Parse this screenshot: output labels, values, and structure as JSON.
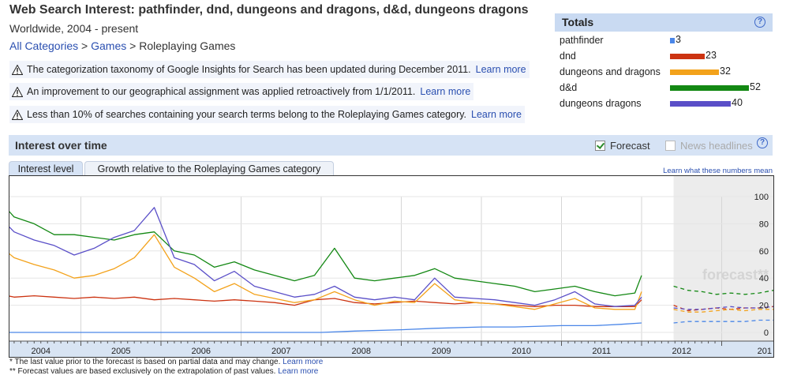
{
  "header": {
    "title": "Web Search Interest: pathfinder, dnd, dungeons and dragons, d&d, dungeons dragons",
    "subtitle": "Worldwide, 2004 - present",
    "breadcrumb": [
      "All Categories",
      "Games",
      "Roleplaying Games"
    ],
    "breadcrumb_sep": ">"
  },
  "notices": [
    {
      "text": "The categorization taxonomy of Google Insights for Search has been updated during December 2011.",
      "link": "Learn more"
    },
    {
      "text": "An improvement to our geographical assignment was applied retroactively from 1/1/2011.",
      "link": "Learn more"
    },
    {
      "text": "Less than 10% of searches containing your search terms belong to the Roleplaying Games category.",
      "link": "Learn more"
    }
  ],
  "totals": {
    "title": "Totals",
    "help_icon": "?",
    "rows": [
      {
        "name": "pathfinder",
        "value": 3,
        "color": "#4a86e8"
      },
      {
        "name": "dnd",
        "value": 23,
        "color": "#cc3311"
      },
      {
        "name": "dungeons and dragons",
        "value": 32,
        "color": "#f3a21b"
      },
      {
        "name": "d&d",
        "value": 52,
        "color": "#138813"
      },
      {
        "name": "dungeons dragons",
        "value": 40,
        "color": "#5a4fc8"
      }
    ]
  },
  "interest": {
    "title": "Interest over time",
    "forecast_label": "Forecast",
    "forecast_checked": true,
    "headlines_label": "News headlines",
    "headlines_checked": false,
    "help_icon": "?"
  },
  "tabs": [
    {
      "label": "Interest level",
      "active": true
    },
    {
      "label": "Growth relative to the Roleplaying Games category",
      "active": false
    }
  ],
  "learn_numbers": "Learn what these numbers mean",
  "footnotes": [
    {
      "text": "* The last value prior to the forecast is based on partial data and may change.",
      "link": "Learn more"
    },
    {
      "text": "** Forecast values are based exclusively on the extrapolation of past values.",
      "link": "Learn more"
    }
  ],
  "chart_data": {
    "type": "line",
    "x_start": "2004-01",
    "x_tick_labels": [
      "2004",
      "2005",
      "2006",
      "2007",
      "2008",
      "2009",
      "2010",
      "2011",
      "2012",
      "201"
    ],
    "y_ticks": [
      0,
      20,
      40,
      60,
      80,
      100
    ],
    "ylim": [
      0,
      100
    ],
    "forecast_label": "forecast**",
    "forecast_start": "2012-01",
    "series": [
      {
        "name": "pathfinder",
        "color": "#4a86e8",
        "x": [
          "2004-01",
          "2006-01",
          "2008-01",
          "2008-06",
          "2009-01",
          "2009-06",
          "2010-01",
          "2010-06",
          "2011-01",
          "2011-06",
          "2011-10",
          "2012-01"
        ],
        "values": [
          0,
          0,
          0,
          1,
          2,
          3,
          4,
          4,
          5,
          5,
          6,
          7
        ],
        "forecast": [
          7,
          8,
          8,
          8,
          8,
          8,
          9,
          9
        ]
      },
      {
        "name": "dnd",
        "color": "#cc3311",
        "x": [
          "2004-01",
          "2004-03",
          "2004-06",
          "2004-09",
          "2004-12",
          "2005-03",
          "2005-06",
          "2005-09",
          "2005-12",
          "2006-03",
          "2006-06",
          "2006-09",
          "2006-12",
          "2007-03",
          "2007-06",
          "2007-09",
          "2007-12",
          "2008-03",
          "2008-06",
          "2008-09",
          "2008-12",
          "2009-03",
          "2009-06",
          "2009-09",
          "2009-12",
          "2010-03",
          "2010-06",
          "2010-09",
          "2010-12",
          "2011-03",
          "2011-06",
          "2011-09",
          "2011-12",
          "2012-01"
        ],
        "values": [
          28,
          26,
          27,
          26,
          25,
          26,
          25,
          26,
          24,
          25,
          24,
          23,
          24,
          23,
          22,
          20,
          24,
          25,
          22,
          21,
          22,
          23,
          22,
          21,
          22,
          21,
          20,
          19,
          20,
          20,
          19,
          19,
          19,
          24
        ],
        "forecast": [
          20,
          16,
          17,
          18,
          17,
          18,
          18,
          19
        ]
      },
      {
        "name": "dungeons and dragons",
        "color": "#f3a21b",
        "x": [
          "2004-01",
          "2004-03",
          "2004-06",
          "2004-09",
          "2004-12",
          "2005-03",
          "2005-06",
          "2005-09",
          "2005-12",
          "2006-03",
          "2006-06",
          "2006-09",
          "2006-12",
          "2007-03",
          "2007-06",
          "2007-09",
          "2007-12",
          "2008-03",
          "2008-06",
          "2008-09",
          "2008-12",
          "2009-03",
          "2009-06",
          "2009-09",
          "2009-12",
          "2010-03",
          "2010-06",
          "2010-09",
          "2010-12",
          "2011-03",
          "2011-06",
          "2011-09",
          "2011-12",
          "2012-01"
        ],
        "values": [
          63,
          55,
          50,
          46,
          40,
          42,
          47,
          55,
          72,
          48,
          40,
          30,
          36,
          28,
          25,
          22,
          24,
          30,
          24,
          20,
          23,
          22,
          36,
          24,
          22,
          21,
          19,
          17,
          21,
          25,
          18,
          17,
          17,
          30
        ],
        "forecast": [
          17,
          15,
          15,
          16,
          17,
          16,
          17,
          17
        ]
      },
      {
        "name": "d&d",
        "color": "#138813",
        "x": [
          "2004-01",
          "2004-03",
          "2004-06",
          "2004-09",
          "2004-12",
          "2005-03",
          "2005-06",
          "2005-09",
          "2005-12",
          "2006-03",
          "2006-06",
          "2006-09",
          "2006-12",
          "2007-03",
          "2007-06",
          "2007-09",
          "2007-12",
          "2008-03",
          "2008-06",
          "2008-09",
          "2008-12",
          "2009-03",
          "2009-06",
          "2009-09",
          "2009-12",
          "2010-03",
          "2010-06",
          "2010-09",
          "2010-12",
          "2011-03",
          "2011-06",
          "2011-09",
          "2011-12",
          "2012-01"
        ],
        "values": [
          96,
          85,
          80,
          72,
          72,
          70,
          68,
          72,
          74,
          60,
          57,
          48,
          52,
          46,
          42,
          38,
          42,
          62,
          40,
          38,
          40,
          42,
          47,
          40,
          38,
          36,
          34,
          30,
          32,
          34,
          30,
          27,
          29,
          42
        ],
        "forecast": [
          34,
          31,
          30,
          28,
          29,
          28,
          29,
          31
        ]
      },
      {
        "name": "dungeons dragons",
        "color": "#5a4fc8",
        "x": [
          "2004-01",
          "2004-03",
          "2004-06",
          "2004-09",
          "2004-12",
          "2005-03",
          "2005-06",
          "2005-09",
          "2005-12",
          "2006-03",
          "2006-06",
          "2006-09",
          "2006-12",
          "2007-03",
          "2007-06",
          "2007-09",
          "2007-12",
          "2008-03",
          "2008-06",
          "2008-09",
          "2008-12",
          "2009-03",
          "2009-06",
          "2009-09",
          "2009-12",
          "2010-03",
          "2010-06",
          "2010-09",
          "2010-12",
          "2011-03",
          "2011-06",
          "2011-09",
          "2011-12",
          "2012-01"
        ],
        "values": [
          84,
          74,
          68,
          64,
          57,
          62,
          70,
          75,
          92,
          55,
          50,
          38,
          45,
          34,
          30,
          26,
          28,
          34,
          26,
          24,
          26,
          24,
          40,
          26,
          25,
          24,
          22,
          20,
          24,
          30,
          21,
          19,
          20,
          26
        ],
        "forecast": [
          18,
          17,
          17,
          18,
          19,
          18,
          18,
          19
        ]
      }
    ]
  }
}
